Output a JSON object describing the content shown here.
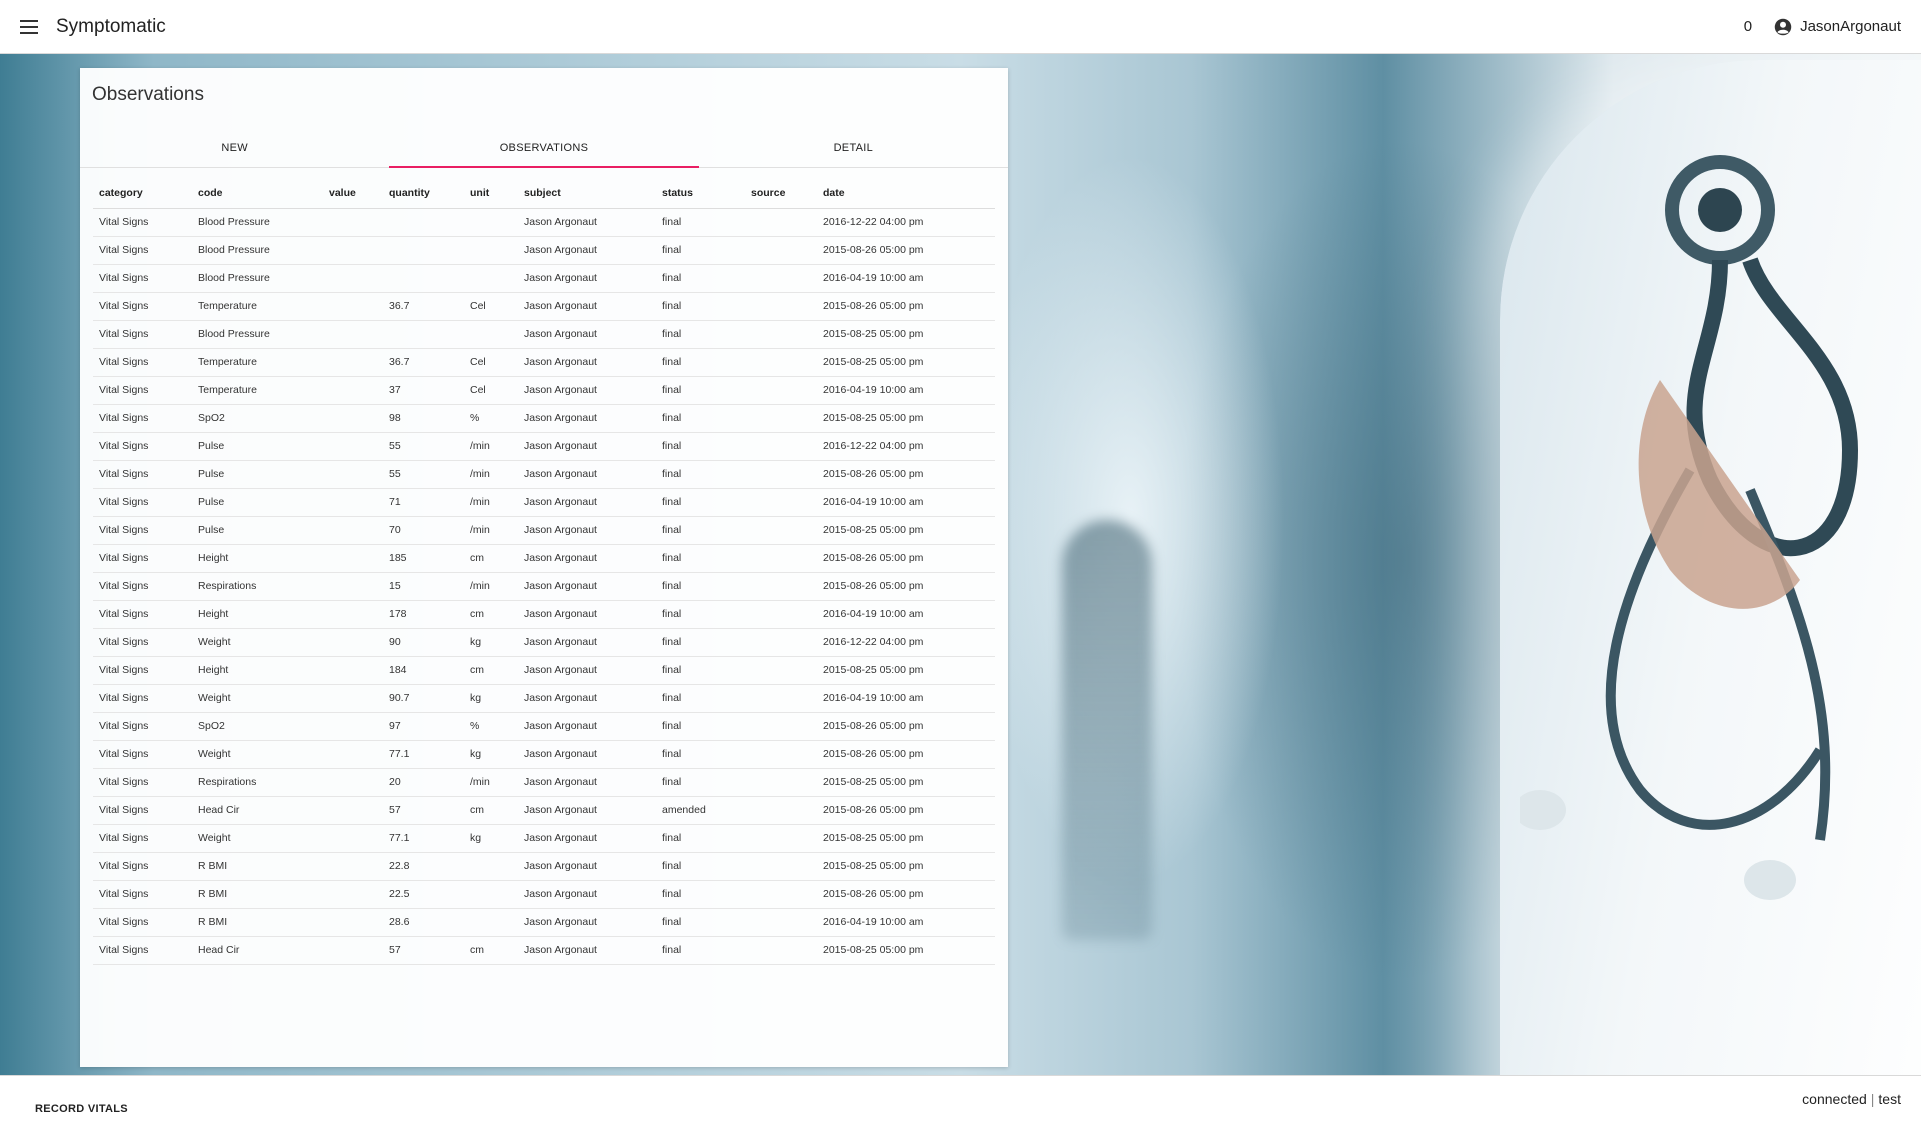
{
  "app": {
    "title": "Symptomatic"
  },
  "header": {
    "notification_count": "0",
    "username": "JasonArgonaut"
  },
  "card": {
    "title": "Observations",
    "tabs": [
      {
        "label": "NEW",
        "active": false
      },
      {
        "label": "OBSERVATIONS",
        "active": true
      },
      {
        "label": "DETAIL",
        "active": false
      }
    ]
  },
  "table": {
    "columns": [
      "category",
      "code",
      "value",
      "quantity",
      "unit",
      "subject",
      "status",
      "source",
      "date"
    ],
    "rows": [
      [
        "Vital Signs",
        "Blood Pressure",
        "",
        "",
        "",
        "Jason Argonaut",
        "final",
        "",
        "2016-12-22 04:00 pm"
      ],
      [
        "Vital Signs",
        "Blood Pressure",
        "",
        "",
        "",
        "Jason Argonaut",
        "final",
        "",
        "2015-08-26 05:00 pm"
      ],
      [
        "Vital Signs",
        "Blood Pressure",
        "",
        "",
        "",
        "Jason Argonaut",
        "final",
        "",
        "2016-04-19 10:00 am"
      ],
      [
        "Vital Signs",
        "Temperature",
        "",
        "36.7",
        "Cel",
        "Jason Argonaut",
        "final",
        "",
        "2015-08-26 05:00 pm"
      ],
      [
        "Vital Signs",
        "Blood Pressure",
        "",
        "",
        "",
        "Jason Argonaut",
        "final",
        "",
        "2015-08-25 05:00 pm"
      ],
      [
        "Vital Signs",
        "Temperature",
        "",
        "36.7",
        "Cel",
        "Jason Argonaut",
        "final",
        "",
        "2015-08-25 05:00 pm"
      ],
      [
        "Vital Signs",
        "Temperature",
        "",
        "37",
        "Cel",
        "Jason Argonaut",
        "final",
        "",
        "2016-04-19 10:00 am"
      ],
      [
        "Vital Signs",
        "SpO2",
        "",
        "98",
        "%",
        "Jason Argonaut",
        "final",
        "",
        "2015-08-25 05:00 pm"
      ],
      [
        "Vital Signs",
        "Pulse",
        "",
        "55",
        "/min",
        "Jason Argonaut",
        "final",
        "",
        "2016-12-22 04:00 pm"
      ],
      [
        "Vital Signs",
        "Pulse",
        "",
        "55",
        "/min",
        "Jason Argonaut",
        "final",
        "",
        "2015-08-26 05:00 pm"
      ],
      [
        "Vital Signs",
        "Pulse",
        "",
        "71",
        "/min",
        "Jason Argonaut",
        "final",
        "",
        "2016-04-19 10:00 am"
      ],
      [
        "Vital Signs",
        "Pulse",
        "",
        "70",
        "/min",
        "Jason Argonaut",
        "final",
        "",
        "2015-08-25 05:00 pm"
      ],
      [
        "Vital Signs",
        "Height",
        "",
        "185",
        "cm",
        "Jason Argonaut",
        "final",
        "",
        "2015-08-26 05:00 pm"
      ],
      [
        "Vital Signs",
        "Respirations",
        "",
        "15",
        "/min",
        "Jason Argonaut",
        "final",
        "",
        "2015-08-26 05:00 pm"
      ],
      [
        "Vital Signs",
        "Height",
        "",
        "178",
        "cm",
        "Jason Argonaut",
        "final",
        "",
        "2016-04-19 10:00 am"
      ],
      [
        "Vital Signs",
        "Weight",
        "",
        "90",
        "kg",
        "Jason Argonaut",
        "final",
        "",
        "2016-12-22 04:00 pm"
      ],
      [
        "Vital Signs",
        "Height",
        "",
        "184",
        "cm",
        "Jason Argonaut",
        "final",
        "",
        "2015-08-25 05:00 pm"
      ],
      [
        "Vital Signs",
        "Weight",
        "",
        "90.7",
        "kg",
        "Jason Argonaut",
        "final",
        "",
        "2016-04-19 10:00 am"
      ],
      [
        "Vital Signs",
        "SpO2",
        "",
        "97",
        "%",
        "Jason Argonaut",
        "final",
        "",
        "2015-08-26 05:00 pm"
      ],
      [
        "Vital Signs",
        "Weight",
        "",
        "77.1",
        "kg",
        "Jason Argonaut",
        "final",
        "",
        "2015-08-26 05:00 pm"
      ],
      [
        "Vital Signs",
        "Respirations",
        "",
        "20",
        "/min",
        "Jason Argonaut",
        "final",
        "",
        "2015-08-25 05:00 pm"
      ],
      [
        "Vital Signs",
        "Head Cir",
        "",
        "57",
        "cm",
        "Jason Argonaut",
        "amended",
        "",
        "2015-08-26 05:00 pm"
      ],
      [
        "Vital Signs",
        "Weight",
        "",
        "77.1",
        "kg",
        "Jason Argonaut",
        "final",
        "",
        "2015-08-25 05:00 pm"
      ],
      [
        "Vital Signs",
        "R BMI",
        "",
        "22.8",
        "",
        "Jason Argonaut",
        "final",
        "",
        "2015-08-25 05:00 pm"
      ],
      [
        "Vital Signs",
        "R BMI",
        "",
        "22.5",
        "",
        "Jason Argonaut",
        "final",
        "",
        "2015-08-26 05:00 pm"
      ],
      [
        "Vital Signs",
        "R BMI",
        "",
        "28.6",
        "",
        "Jason Argonaut",
        "final",
        "",
        "2016-04-19 10:00 am"
      ],
      [
        "Vital Signs",
        "Head Cir",
        "",
        "57",
        "cm",
        "Jason Argonaut",
        "final",
        "",
        "2015-08-25 05:00 pm"
      ]
    ]
  },
  "footer": {
    "record_vitals_label": "RECORD VITALS",
    "status_connected": "connected",
    "status_separator": "|",
    "status_env": "test"
  },
  "icons": {
    "menu": "menu-icon",
    "user": "account-circle-icon",
    "background": "stethoscope-icon"
  },
  "colors": {
    "tab_indicator": "#e91e63",
    "header_bg": "#ffffff"
  }
}
